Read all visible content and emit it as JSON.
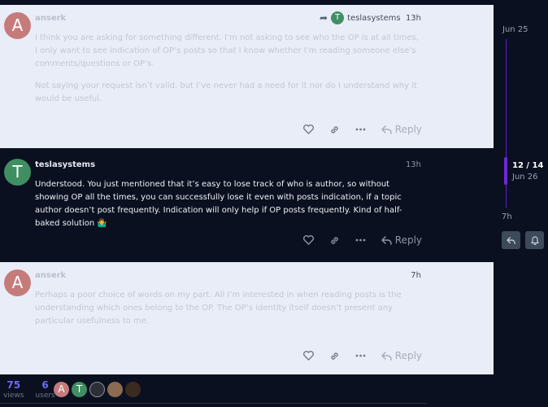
{
  "posts": [
    {
      "avatar_letter": "A",
      "username": "anserk",
      "reply_to_username": "teslasystems",
      "reply_to_avatar_letter": "T",
      "time": "13h",
      "paragraphs": [
        "I think you are asking for something different. I’m not asking to see who the OP is at all times, I only want to see indication of OP’s posts so that I know whether I’m reading someone else’s comments/questions or OP’s.",
        "Not saying your request isn’t valid, but I’ve never had a need for it nor do I understand why it would be useful."
      ],
      "reply_label": "Reply"
    },
    {
      "avatar_letter": "T",
      "username": "teslasystems",
      "time": "13h",
      "paragraphs": [
        "Understood. You just mentioned that it’s easy to lose track of who is author, so without showing OP all the times, you can successfully lose it even with posts indication, if a topic author doesn’t post frequently. Indication will only help if OP posts frequently. Kind of half-baked solution 🤷‍♂️"
      ],
      "reply_label": "Reply"
    },
    {
      "avatar_letter": "A",
      "username": "anserk",
      "time": "7h",
      "paragraphs": [
        "Perhaps a poor choice of words on my part. All I’m interested in when reading posts is the understanding which ones belong to the OP. The OP’s identity itself doesn’t present any particular usefulness to me."
      ],
      "reply_label": "Reply"
    }
  ],
  "timeline": {
    "start_date": "Jun 25",
    "position": "12 / 14",
    "position_date": "Jun 26",
    "end_label": "7h"
  },
  "footer": {
    "views_count": "75",
    "views_label": "views",
    "users_count": "6",
    "users_label": "users",
    "participant_avatars": [
      "A",
      "T",
      "",
      "",
      ""
    ]
  },
  "colors": {
    "accent": "#6d28d9",
    "link_count": "#6d6bf2",
    "avatar_a": "#c67b7b",
    "avatar_t": "#3f8f63"
  }
}
